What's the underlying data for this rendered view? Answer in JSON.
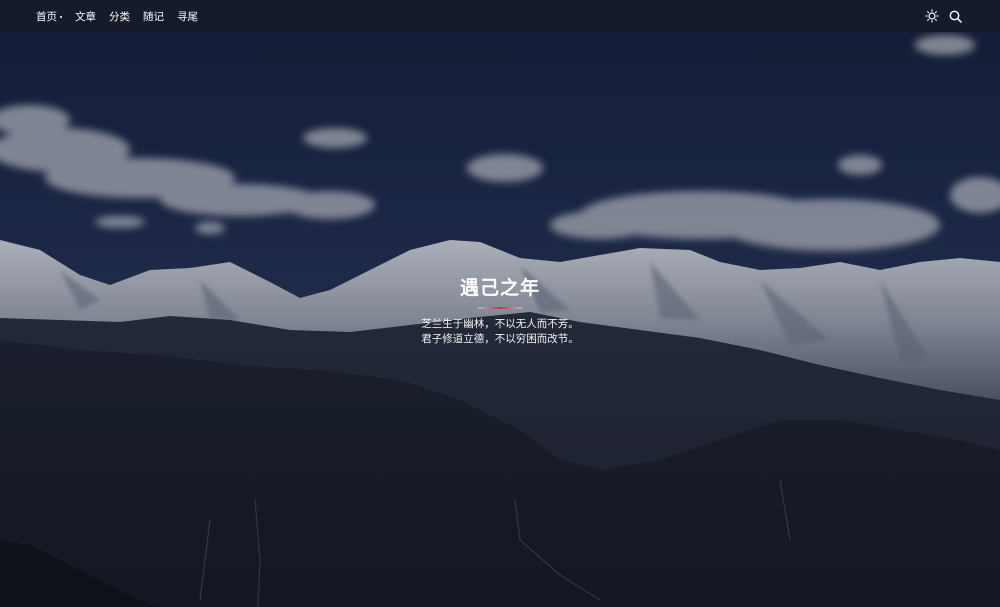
{
  "nav": {
    "items": [
      {
        "label": "首页"
      },
      {
        "label": "文章"
      },
      {
        "label": "分类"
      },
      {
        "label": "随记"
      },
      {
        "label": "寻尾"
      }
    ],
    "theme_toggle_icon": "sun-icon",
    "search_icon": "search-icon"
  },
  "hero": {
    "title": "遇己之年",
    "lines": [
      "芝兰生于幽林，不以无人而不芳。",
      "君子修道立德，不以穷困而改节。"
    ]
  },
  "colors": {
    "navbar_bg": "#161b2b",
    "divider_accent": "#c0374a",
    "sky": "#1c2748",
    "text": "#ffffff"
  }
}
